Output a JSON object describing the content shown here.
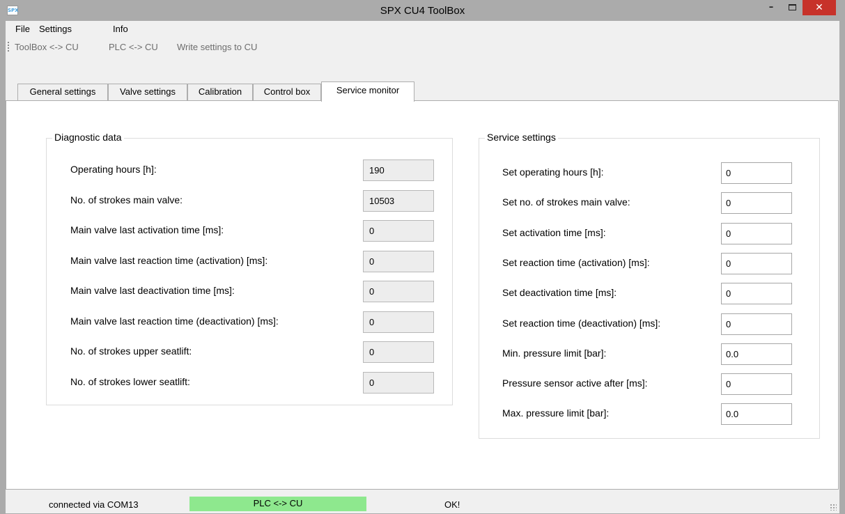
{
  "window": {
    "title": "SPX CU4 ToolBox",
    "icon_text": "SPX",
    "min_glyph": "–",
    "close_glyph": "✕"
  },
  "menu": [
    "File",
    "Settings",
    "Info"
  ],
  "toolbar": [
    "ToolBox <-> CU",
    "PLC <-> CU",
    "Write settings to CU"
  ],
  "tabs": [
    "General settings",
    "Valve settings",
    "Calibration",
    "Control box",
    "Service monitor"
  ],
  "active_tab": "Service monitor",
  "diagnostic": {
    "title": "Diagnostic data",
    "rows": [
      {
        "label": "Operating hours [h]:",
        "value": "190"
      },
      {
        "label": "No. of strokes main valve:",
        "value": "10503"
      },
      {
        "label": "Main valve last activation time [ms]:",
        "value": "0"
      },
      {
        "label": "Main valve last reaction time (activation) [ms]:",
        "value": "0"
      },
      {
        "label": "Main valve last deactivation time [ms]:",
        "value": "0"
      },
      {
        "label": "Main valve last reaction time (deactivation)  [ms]:",
        "value": "0"
      },
      {
        "label": "No. of strokes upper seatlift:",
        "value": "0"
      },
      {
        "label": "No. of strokes lower seatlift:",
        "value": "0"
      }
    ]
  },
  "service": {
    "title": "Service settings",
    "rows": [
      {
        "label": "Set operating hours [h]:",
        "value": "0"
      },
      {
        "label": "Set no. of strokes main valve:",
        "value": "0"
      },
      {
        "label": "Set activation time [ms]:",
        "value": "0"
      },
      {
        "label": "Set reaction time (activation) [ms]:",
        "value": "0"
      },
      {
        "label": "Set deactivation time [ms]:",
        "value": "0"
      },
      {
        "label": "Set reaction time (deactivation) [ms]:",
        "value": "0"
      },
      {
        "label": "Min. pressure limit [bar]:",
        "value": "0.0"
      },
      {
        "label": "Pressure sensor active after [ms]:",
        "value": "0"
      },
      {
        "label": "Max. pressure limit [bar]:",
        "value": "0.0"
      }
    ]
  },
  "status": {
    "connection": "connected via COM13",
    "mode": "PLC <-> CU",
    "mode_color": "#8ee88e",
    "result": "OK!"
  },
  "colors": {
    "close_button": "#c7322a",
    "app_icon_accent": "#4aa3df"
  }
}
